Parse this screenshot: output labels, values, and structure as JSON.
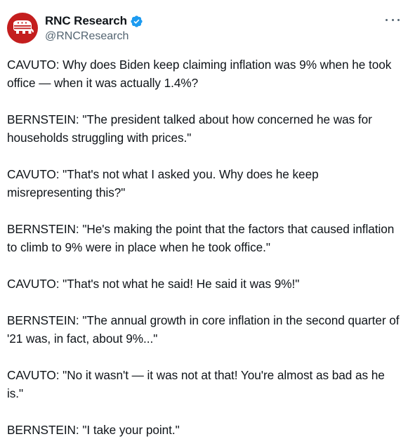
{
  "author": {
    "display_name": "RNC Research",
    "handle": "@RNCResearch",
    "verified": true,
    "avatar_icon": "republican-elephant-icon",
    "avatar_color": "#c41e1e"
  },
  "more_icon": "more-options-icon",
  "paragraphs": [
    "CAVUTO: Why does Biden keep claiming inflation was 9% when he took office — when it was actually 1.4%?",
    "BERNSTEIN: \"The president talked about how concerned he was for households struggling with prices.\"",
    "CAVUTO: \"That's not what I asked you. Why does he keep misrepresenting this?\"",
    "BERNSTEIN: \"He's making the point that the factors that caused inflation to climb to 9% were in place when he took office.\"",
    "CAVUTO: \"That's not what he said! He said it was 9%!\"",
    "BERNSTEIN: \"The annual growth in core inflation in the second quarter of '21 was, in fact, about 9%...\"",
    "CAVUTO: \"No it wasn't — it was not at that! You're almost as bad as he is.\"",
    "BERNSTEIN: \"I take your point.\""
  ],
  "colors": {
    "text": "#0f1419",
    "secondary": "#536471",
    "verified_blue": "#1d9bf0"
  }
}
